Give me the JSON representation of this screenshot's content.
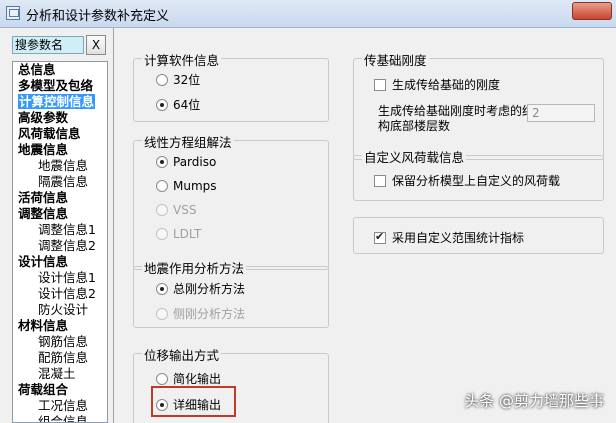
{
  "window": {
    "title": "分析和设计参数补充定义"
  },
  "search": {
    "label": "搜参数名",
    "clear_label": "X"
  },
  "tree": [
    {
      "label": "总信息",
      "level": 0
    },
    {
      "label": "多模型及包络",
      "level": 0
    },
    {
      "label": "计算控制信息",
      "level": 0,
      "selected": true
    },
    {
      "label": "高级参数",
      "level": 0
    },
    {
      "label": "风荷载信息",
      "level": 0
    },
    {
      "label": "地震信息",
      "level": 0
    },
    {
      "label": "地震信息",
      "level": 1
    },
    {
      "label": "隔震信息",
      "level": 1
    },
    {
      "label": "活荷信息",
      "level": 0
    },
    {
      "label": "调整信息",
      "level": 0
    },
    {
      "label": "调整信息1",
      "level": 1
    },
    {
      "label": "调整信息2",
      "level": 1
    },
    {
      "label": "设计信息",
      "level": 0
    },
    {
      "label": "设计信息1",
      "level": 1
    },
    {
      "label": "设计信息2",
      "level": 1
    },
    {
      "label": "防火设计",
      "level": 1
    },
    {
      "label": "材料信息",
      "level": 0
    },
    {
      "label": "钢筋信息",
      "level": 1
    },
    {
      "label": "配筋信息",
      "level": 1
    },
    {
      "label": "混凝土",
      "level": 1
    },
    {
      "label": "荷载组合",
      "level": 0
    },
    {
      "label": "工况信息",
      "level": 1
    },
    {
      "label": "组合信息",
      "level": 1
    }
  ],
  "software": {
    "title": "计算软件信息",
    "opt32": "32位",
    "opt64": "64位",
    "selected": "64位"
  },
  "solver": {
    "title": "线性方程组解法",
    "pardiso": "Pardiso",
    "mumps": "Mumps",
    "vss": "VSS",
    "ldlt": "LDLT",
    "selected": "Pardiso"
  },
  "seismic": {
    "title": "地震作用分析方法",
    "total": "总刚分析方法",
    "lateral": "侧刚分析方法",
    "selected": "总刚分析方法"
  },
  "displacement": {
    "title": "位移输出方式",
    "simple": "简化输出",
    "detail": "详细输出",
    "selected": "详细输出"
  },
  "foundation": {
    "title": "传基础刚度",
    "gen_label": "生成传给基础的刚度",
    "gen_checked": false,
    "floors_label_1": "生成传给基础刚度时考虑的结",
    "floors_label_2": "构底部楼层数",
    "floors_value": "2"
  },
  "custom_wind": {
    "title": "自定义风荷载信息",
    "keep_label": "保留分析模型上自定义的风荷载",
    "keep_checked": false
  },
  "custom_range": {
    "label": "采用自定义范围统计指标",
    "checked": true
  },
  "watermark": "头条 @剪力墙那些事"
}
